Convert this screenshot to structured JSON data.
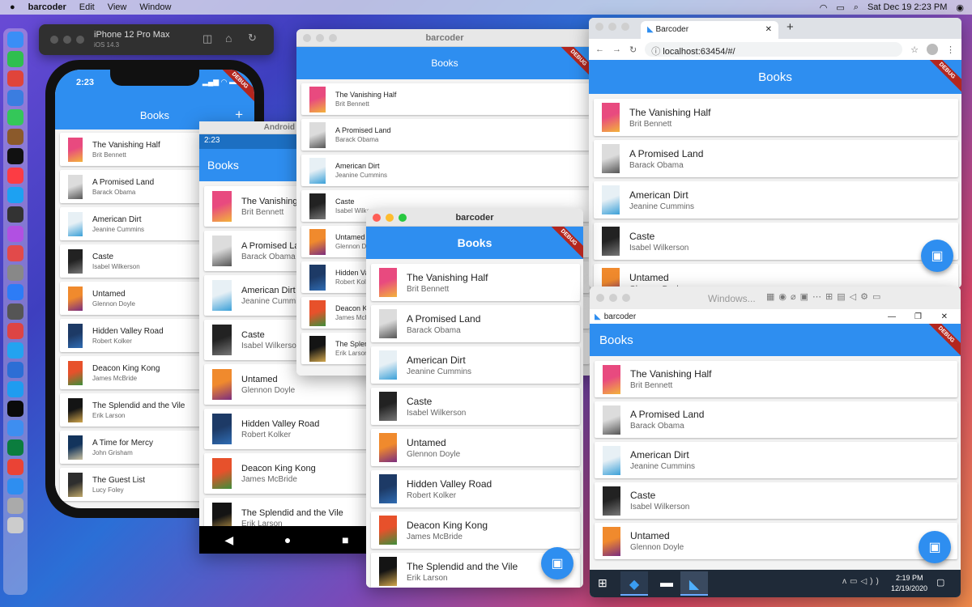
{
  "menubar": {
    "app": "barcoder",
    "menus": [
      "Edit",
      "View",
      "Window"
    ],
    "datetime": "Sat Dec 19  2:23 PM"
  },
  "books": [
    {
      "title": "The Vanishing Half",
      "author": "Brit Bennett",
      "colors": [
        "#e84a7f",
        "#f3b33b"
      ]
    },
    {
      "title": "A Promised Land",
      "author": "Barack Obama",
      "colors": [
        "#dcdcdc",
        "#555555"
      ]
    },
    {
      "title": "American Dirt",
      "author": "Jeanine Cummins",
      "colors": [
        "#e7f0f5",
        "#3aa0d8"
      ]
    },
    {
      "title": "Caste",
      "author": "Isabel Wilkerson",
      "colors": [
        "#222222",
        "#777777"
      ]
    },
    {
      "title": "Untamed",
      "author": "Glennon Doyle",
      "colors": [
        "#f08a2d",
        "#7b2d7f"
      ]
    },
    {
      "title": "Hidden Valley Road",
      "author": "Robert Kolker",
      "colors": [
        "#1d3a66",
        "#2f6cb3"
      ]
    },
    {
      "title": "Deacon King Kong",
      "author": "James McBride",
      "colors": [
        "#e7512b",
        "#3e8f3a"
      ]
    },
    {
      "title": "The Splendid and the Vile",
      "author": "Erik Larson",
      "colors": [
        "#141414",
        "#d1a64d"
      ]
    },
    {
      "title": "A Time for Mercy",
      "author": "John Grisham",
      "colors": [
        "#13345c",
        "#c9c0a0"
      ]
    },
    {
      "title": "The Guest List",
      "author": "Lucy Foley",
      "colors": [
        "#2e2e2e",
        "#bfa86a"
      ]
    }
  ],
  "common": {
    "appbar_title": "Books",
    "debug_label": "DEBUG",
    "add_glyph": "+"
  },
  "ios": {
    "device": "iPhone 12 Pro Max",
    "os": "iOS 14.3",
    "time": "2:23"
  },
  "android": {
    "title": "Android Em",
    "time": "2:23"
  },
  "mac1": {
    "title": "barcoder"
  },
  "mac2": {
    "title": "barcoder"
  },
  "chrome": {
    "tab_title": "Barcoder",
    "url": "localhost:63454/#/"
  },
  "windows": {
    "vm_title": "Windows...",
    "app_title": "barcoder",
    "time": "2:19 PM",
    "date": "12/19/2020"
  }
}
